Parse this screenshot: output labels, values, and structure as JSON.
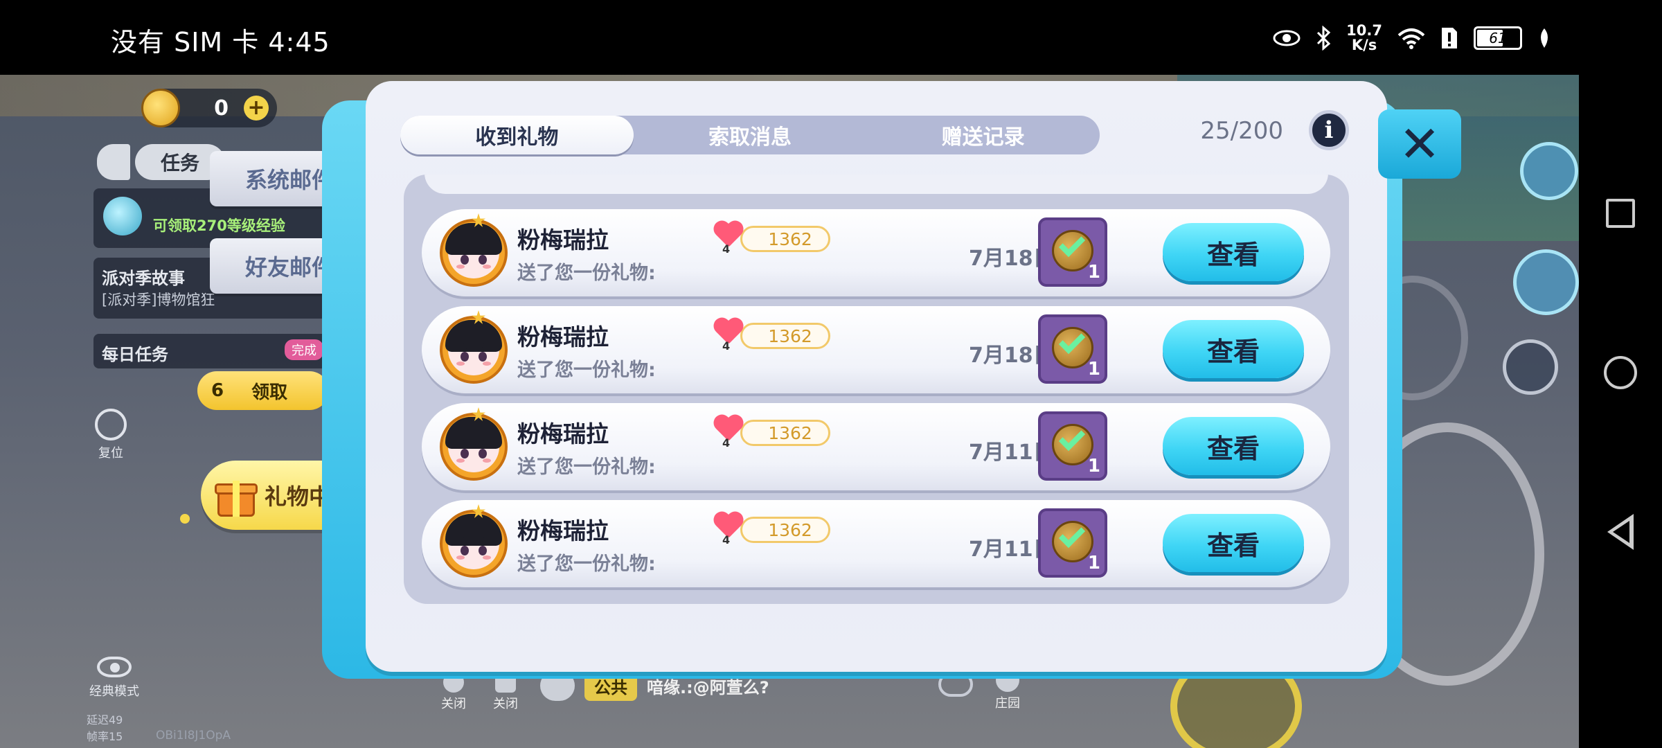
{
  "status_bar": {
    "carrier_time": "没有 SIM 卡 4:45",
    "net_speed_value": "10.7",
    "net_speed_unit": "K/s",
    "battery": "61"
  },
  "hud": {
    "coins": "0",
    "task_tab": "任务",
    "task_exp": "可领取270等级经验",
    "story_title": "派对季故事",
    "story_sub": "[派对季]博物馆狂",
    "daily_title": "每日任务",
    "daily_badge": "完成",
    "claim_count": "6",
    "claim_label": "领取",
    "reset_label": "复位",
    "classic_mode": "经典模式",
    "latency": "延迟49",
    "fps": "帧率15",
    "player_id": "OBi1I8J1OpA",
    "mute_1": "关闭",
    "mute_2": "关闭",
    "manor": "庄园"
  },
  "side_tabs": {
    "system_mail": "系统邮件",
    "friend_mail": "好友邮件",
    "gift_center": "礼物中心"
  },
  "chat": {
    "channel": "公共",
    "message": "喑缘.:@阿萱么?"
  },
  "dialog": {
    "tabs": [
      "收到礼物",
      "索取消息",
      "赠送记录"
    ],
    "active_tab": 0,
    "count": "25/200",
    "info_label": "i",
    "close_label": "✕",
    "rows": [
      {
        "name": "粉梅瑞拉",
        "message": "送了您一份礼物:",
        "intimacy": "1362",
        "heart_level": "4",
        "date": "7月18日",
        "gift_qty": "1",
        "button": "查看"
      },
      {
        "name": "粉梅瑞拉",
        "message": "送了您一份礼物:",
        "intimacy": "1362",
        "heart_level": "4",
        "date": "7月18日",
        "gift_qty": "1",
        "button": "查看"
      },
      {
        "name": "粉梅瑞拉",
        "message": "送了您一份礼物:",
        "intimacy": "1362",
        "heart_level": "4",
        "date": "7月11日",
        "gift_qty": "1",
        "button": "查看"
      },
      {
        "name": "粉梅瑞拉",
        "message": "送了您一份礼物:",
        "intimacy": "1362",
        "heart_level": "4",
        "date": "7月11日",
        "gift_qty": "1",
        "button": "查看"
      }
    ]
  },
  "colors": {
    "accent_cyan": "#3fd5f5",
    "tab_inactive": "#b3b9d6",
    "heart": "#ff5a78",
    "gift_tile": "#7b5aa8"
  }
}
